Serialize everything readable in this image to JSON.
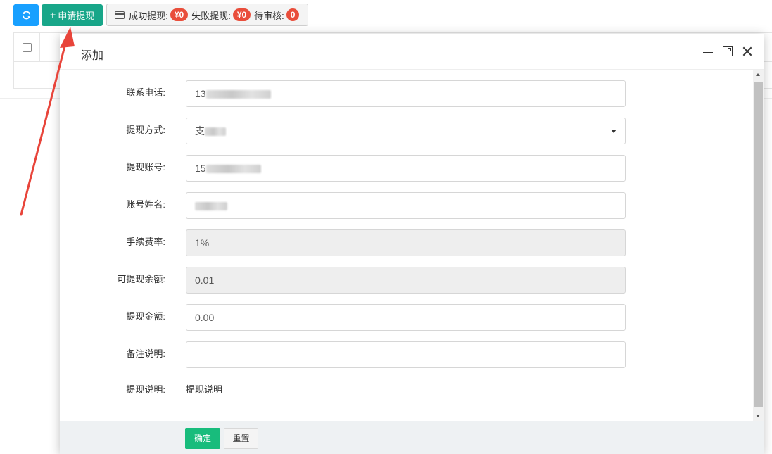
{
  "toolbar": {
    "refresh_icon": "refresh-icon",
    "apply_label": "申请提现",
    "apply_icon": "+",
    "stats": {
      "success_label": "成功提现:",
      "success_value": "¥0",
      "fail_label": "失败提现:",
      "fail_value": "¥0",
      "pending_label": "待审核:",
      "pending_value": "0"
    }
  },
  "modal": {
    "title": "添加",
    "fields": [
      {
        "label": "联系电话:",
        "value": "13"
      },
      {
        "label": "提现方式:",
        "value": "支"
      },
      {
        "label": "提现账号:",
        "value": "15"
      },
      {
        "label": "账号姓名:",
        "value": ""
      },
      {
        "label": "手续费率:",
        "value": "1%"
      },
      {
        "label": "可提现余额:",
        "value": "0.01"
      },
      {
        "label": "提现金额:",
        "value": "0.00"
      },
      {
        "label": "备注说明:",
        "value": ""
      },
      {
        "label": "提现说明:",
        "value": "提现说明"
      }
    ],
    "ok_label": "确定",
    "reset_label": "重置"
  },
  "colors": {
    "refresh_button": "#18a0ff",
    "apply_button": "#18a689",
    "badge": "#e94e3b",
    "ok_button": "#18bc7c",
    "annotation_arrow": "#e8443a"
  }
}
